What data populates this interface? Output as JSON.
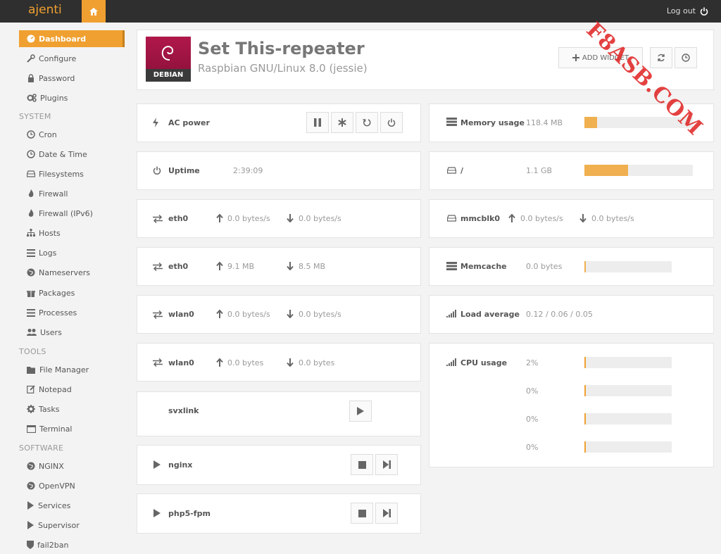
{
  "app": {
    "brand": "ajenti",
    "logout_label": "Log out"
  },
  "colors": {
    "accent": "#f0a030",
    "topbar": "#2f2f2f"
  },
  "sidebar": {
    "items": [
      {
        "label": "Dashboard",
        "icon": "dashboard-icon",
        "active": true
      },
      {
        "label": "Configure",
        "icon": "wrench-icon"
      },
      {
        "label": "Password",
        "icon": "lock-icon"
      },
      {
        "label": "Plugins",
        "icon": "cogs-icon"
      }
    ],
    "system_label": "SYSTEM",
    "system": [
      {
        "label": "Cron",
        "icon": "clock-icon"
      },
      {
        "label": "Date & Time",
        "icon": "clock-icon"
      },
      {
        "label": "Filesystems",
        "icon": "hdd-icon"
      },
      {
        "label": "Firewall",
        "icon": "fire-icon"
      },
      {
        "label": "Firewall (IPv6)",
        "icon": "fire-icon"
      },
      {
        "label": "Hosts",
        "icon": "sitemap-icon"
      },
      {
        "label": "Logs",
        "icon": "list-icon"
      },
      {
        "label": "Nameservers",
        "icon": "globe-icon"
      },
      {
        "label": "Packages",
        "icon": "gift-icon"
      },
      {
        "label": "Processes",
        "icon": "list-icon"
      },
      {
        "label": "Users",
        "icon": "users-icon"
      }
    ],
    "tools_label": "TOOLS",
    "tools": [
      {
        "label": "File Manager",
        "icon": "folder-icon"
      },
      {
        "label": "Notepad",
        "icon": "edit-icon"
      },
      {
        "label": "Tasks",
        "icon": "gear-icon"
      },
      {
        "label": "Terminal",
        "icon": "terminal-icon"
      }
    ],
    "software_label": "SOFTWARE",
    "software": [
      {
        "label": "NGINX",
        "icon": "globe-icon"
      },
      {
        "label": "OpenVPN",
        "icon": "globe-icon"
      },
      {
        "label": "Services",
        "icon": "play-icon"
      },
      {
        "label": "Supervisor",
        "icon": "play-icon"
      },
      {
        "label": "fail2ban",
        "icon": "shield-icon"
      }
    ]
  },
  "header": {
    "hostname": "Set This-repeater",
    "os": "Raspbian GNU/Linux 8.0 (jessie)",
    "logo_caption": "DEBIAN",
    "add_widget_label": "ADD WIDGET"
  },
  "left_widgets": {
    "power": {
      "label": "AC power"
    },
    "uptime": {
      "label": "Uptime",
      "value": "2:39:09"
    },
    "eth0_rate": {
      "label": "eth0",
      "up": "0.0 bytes/s",
      "down": "0.0 bytes/s"
    },
    "eth0_total": {
      "label": "eth0",
      "up": "9.1 MB",
      "down": "8.5 MB"
    },
    "wlan0_rate": {
      "label": "wlan0",
      "up": "0.0 bytes/s",
      "down": "0.0 bytes/s"
    },
    "wlan0_total": {
      "label": "wlan0",
      "up": "0.0 bytes",
      "down": "0.0 bytes"
    },
    "svxlink": {
      "label": "svxlink"
    },
    "nginx": {
      "label": "nginx"
    },
    "php5fpm": {
      "label": "php5-fpm"
    }
  },
  "right_widgets": {
    "memory": {
      "label": "Memory usage",
      "value": "118.4 MB",
      "fraction": 0.12
    },
    "root_fs": {
      "label": "/",
      "value": "1.1 GB",
      "fraction": 0.4
    },
    "mmcblk0": {
      "label": "mmcblk0",
      "up": "0.0 bytes/s",
      "down": "0.0 bytes/s"
    },
    "memcache": {
      "label": "Memcache",
      "value": "0.0 bytes",
      "fraction": 0
    },
    "load": {
      "label": "Load average",
      "value": "0.12 / 0.06 / 0.05"
    },
    "cpu": {
      "label": "CPU usage",
      "cores": [
        {
          "value": "2%",
          "fraction": 0.02
        },
        {
          "value": "0%",
          "fraction": 0.0
        },
        {
          "value": "0%",
          "fraction": 0.0
        },
        {
          "value": "0%",
          "fraction": 0.0
        }
      ]
    }
  },
  "watermark": "F8ASB.COM"
}
